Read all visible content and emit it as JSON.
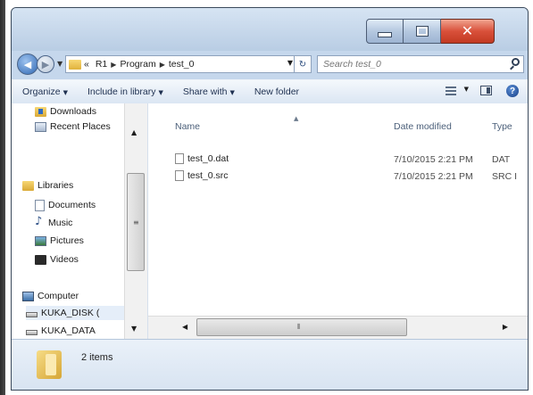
{
  "window": {
    "min_label": "minimize",
    "max_label": "maximize",
    "close_glyph": "✕"
  },
  "nav": {
    "back_glyph": "◀",
    "forward_glyph": "▶",
    "breadcrumb": [
      "«",
      "R1",
      "Program",
      "test_0"
    ],
    "refresh_glyph": "↻",
    "search_placeholder": "Search test_0"
  },
  "toolbar": {
    "organize": "Organize",
    "include_in_library": "Include in library",
    "share_with": "Share with",
    "new_folder": "New folder",
    "help": "?"
  },
  "sidebar": {
    "items": [
      {
        "label": "Downloads",
        "icon": "downloads-icon"
      },
      {
        "label": "Recent Places",
        "icon": "recent-places-icon"
      },
      {
        "label": "Libraries",
        "icon": "libraries-icon"
      },
      {
        "label": "Documents",
        "icon": "documents-icon"
      },
      {
        "label": "Music",
        "icon": "music-icon"
      },
      {
        "label": "Pictures",
        "icon": "pictures-icon"
      },
      {
        "label": "Videos",
        "icon": "videos-icon"
      },
      {
        "label": "Computer",
        "icon": "computer-icon"
      },
      {
        "label": "KUKA_DISK (",
        "icon": "drive-icon"
      },
      {
        "label": "KUKA_DATA",
        "icon": "drive-icon"
      }
    ]
  },
  "filelist": {
    "columns": [
      "Name",
      "Date modified",
      "Type"
    ],
    "files": [
      {
        "name": "test_0.dat",
        "date": "7/10/2015 2:21 PM",
        "type": "DAT"
      },
      {
        "name": "test_0.src",
        "date": "7/10/2015 2:21 PM",
        "type": "SRC I"
      }
    ]
  },
  "details": {
    "item_count": "2 items"
  },
  "colors": {
    "frame": "#c5d7ec",
    "close": "#d9503a",
    "accent": "#2f67b3"
  }
}
